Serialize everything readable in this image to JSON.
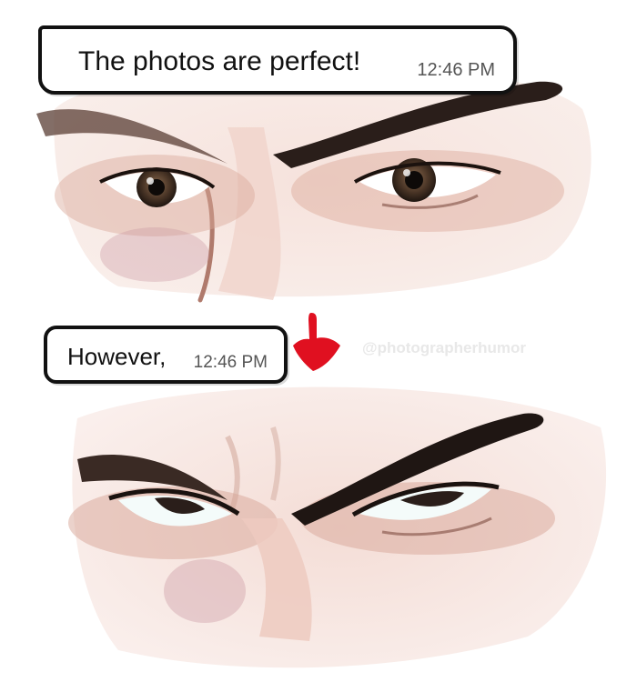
{
  "messages": [
    {
      "text": "The photos are perfect!",
      "time": "12:46 PM"
    },
    {
      "text": "However,",
      "time": "12:46 PM"
    }
  ],
  "watermark": "@photographerhumor",
  "colors": {
    "bubble_border": "#111111",
    "bubble_fill": "#ffffff",
    "arrow": "#e01020",
    "skin": "#f3dcd6",
    "brow": "#2a1e1a"
  },
  "icons": [
    "down-arrow-icon"
  ]
}
